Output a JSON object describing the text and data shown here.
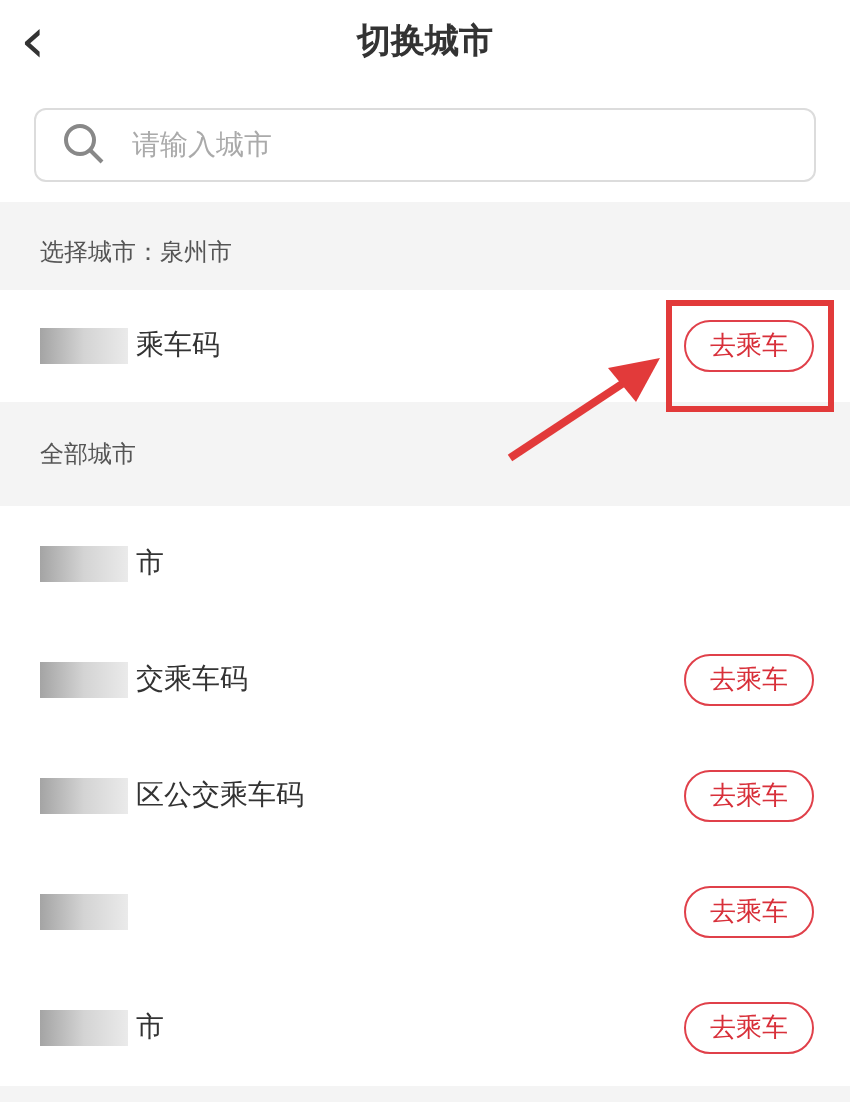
{
  "header": {
    "back_icon": "‹",
    "title": "切换城市"
  },
  "search": {
    "placeholder": "请输入城市"
  },
  "selected_section": {
    "label": "选择城市：泉州市"
  },
  "current_city": {
    "name": "乘车码",
    "redacted": true,
    "button": "去乘车",
    "highlighted": true
  },
  "all_section": {
    "label": "全部城市"
  },
  "cities": [
    {
      "name": "市",
      "redacted": true
    },
    {
      "name": "交乘车码",
      "redacted": true,
      "button": "去乘车"
    },
    {
      "name": "区公交乘车码",
      "redacted": true,
      "button": "去乘车"
    },
    {
      "redacted": true,
      "button": "去乘车"
    },
    {
      "name": "市",
      "redacted": true,
      "button": "去乘车"
    }
  ]
}
